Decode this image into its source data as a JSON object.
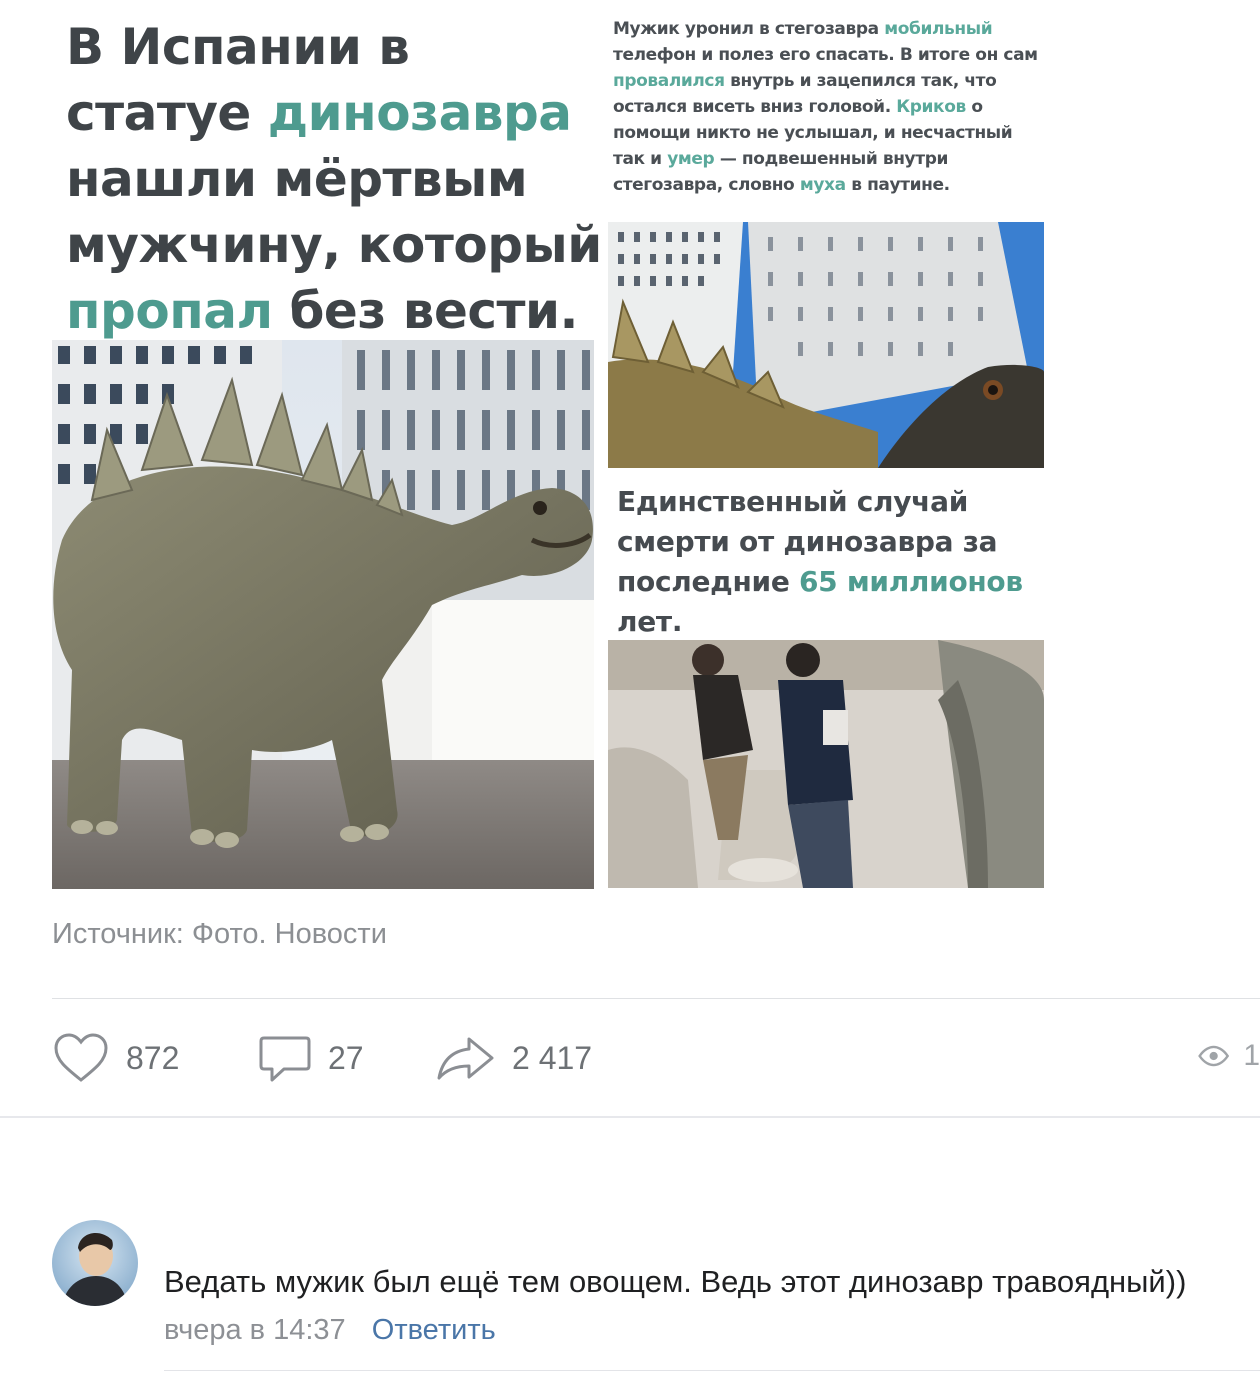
{
  "post": {
    "headline": {
      "part1": "В Испании в статуе ",
      "part2": "динозавра",
      "part3": " нашли мёртвым мужчину, который ",
      "part4": "пропал",
      "part5": " без вести."
    },
    "story": {
      "s1": "Мужик уронил в стегозавра ",
      "s2": "мобильный",
      "s3": " телефон и полез его спасать. В итоге он сам ",
      "s4": "провалился",
      "s5": " внутрь и зацепился так, что остался висеть вниз головой. ",
      "s6": "Криков",
      "s7": " о помощи никто не услышал, и несчастный так и ",
      "s8": "умер",
      "s9": " — подвешенный внутри стегозавра, словно ",
      "s10": "муха",
      "s11": " в паутине."
    },
    "caption": {
      "c1": "Единственный случай смерти от динозавра за последние ",
      "c2": "65 миллионов",
      "c3": " лет."
    },
    "source": "Источник: Фото. Новости",
    "highlight_color": "#4e9b8f"
  },
  "actions": {
    "likes": "872",
    "comments": "27",
    "shares": "2 417",
    "views": "1"
  },
  "comment": {
    "text": "Ведать мужик был ещё тем овощем. Ведь этот динозавр травоядный))",
    "date": "вчера в 14:37",
    "reply_label": "Ответить"
  }
}
